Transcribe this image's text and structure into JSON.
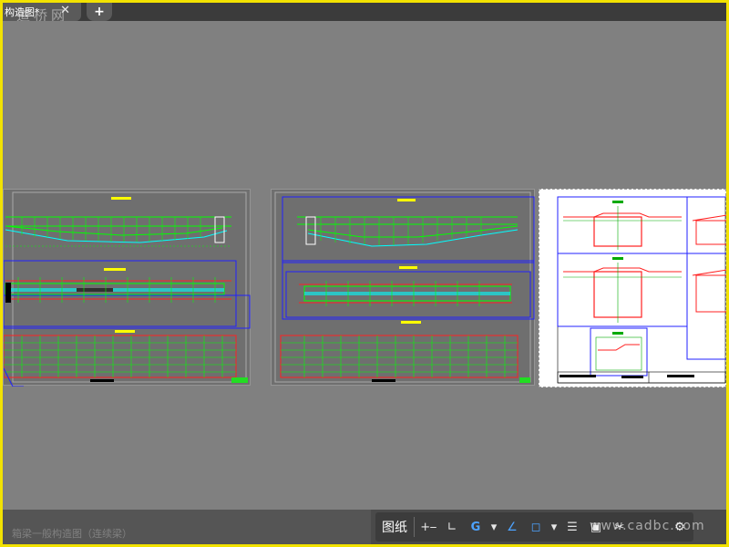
{
  "tabs": {
    "document_title": "构造图*",
    "close_glyph": "✕",
    "new_tab_glyph": "+"
  },
  "watermark": {
    "top": "道桥网",
    "bottom": "www.cadbc.com"
  },
  "status_bar": {
    "layout_label": "图纸",
    "tools": [
      {
        "name": "snap-grid-icon",
        "glyph": "+⎯"
      },
      {
        "name": "ortho-icon",
        "glyph": "∟"
      },
      {
        "name": "polar-tracking-icon",
        "glyph": "G"
      },
      {
        "name": "polar-dropdown-icon",
        "glyph": "▾"
      },
      {
        "name": "isodraft-icon",
        "glyph": "∠"
      },
      {
        "name": "object-snap-icon",
        "glyph": "◻"
      },
      {
        "name": "osnap-dropdown-icon",
        "glyph": "▾"
      },
      {
        "name": "lineweight-icon",
        "glyph": "☰"
      },
      {
        "name": "selection-cycling-icon",
        "glyph": "▣"
      },
      {
        "name": "annotation-tools-icon",
        "glyph": "✂"
      },
      {
        "name": "settings-icon",
        "glyph": "⚙"
      }
    ],
    "background_text": "箱梁一般构造图（连续梁）"
  },
  "colors": {
    "frame": "#f2e200",
    "canvas": "#808080",
    "tabbar": "#3b3b3b",
    "cad_green": "#00ff00",
    "cad_red": "#ff2020",
    "cad_blue": "#2020ff",
    "cad_cyan": "#00ffff"
  }
}
